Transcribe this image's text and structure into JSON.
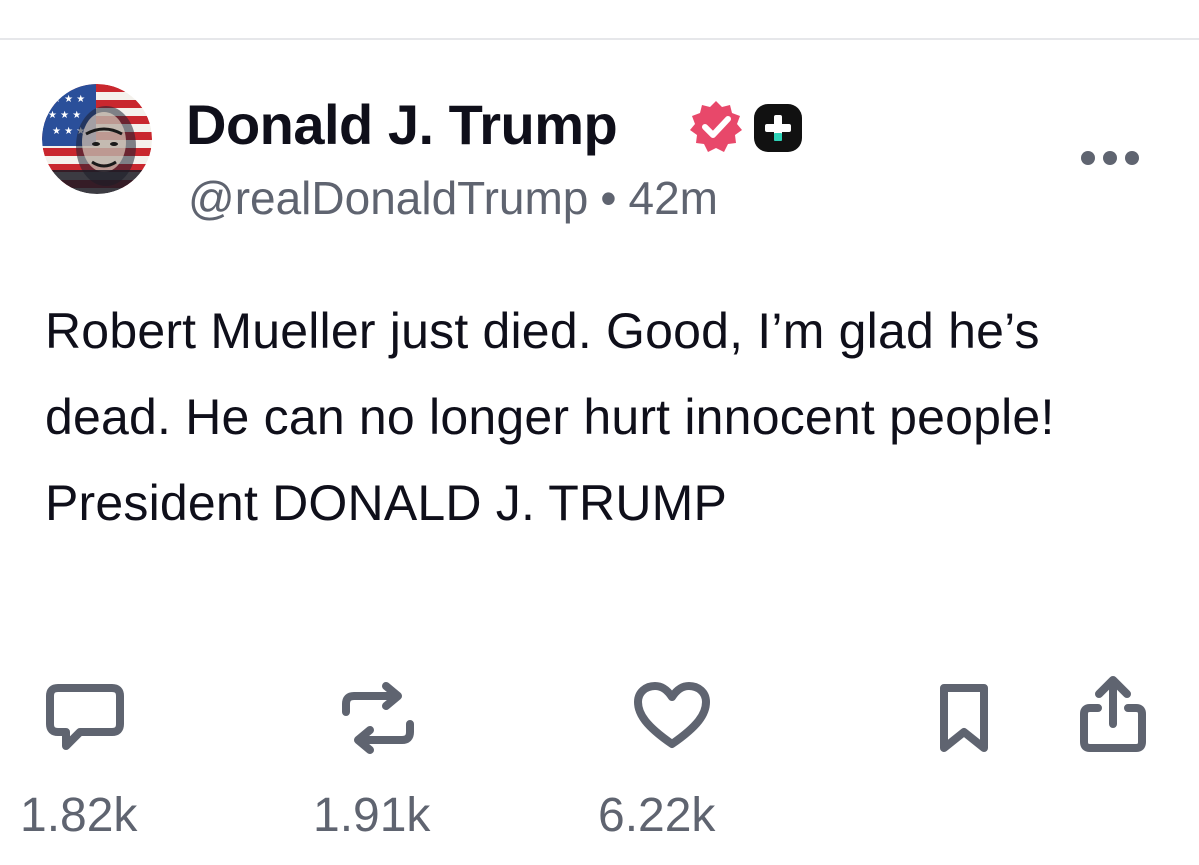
{
  "post": {
    "author": {
      "display_name": "Donald J. Trump",
      "handle": "@realDonaldTrump",
      "separator": "•",
      "timestamp": "42m",
      "avatar_icon": "flag-portrait-avatar",
      "verified_icon": "verified-badge-icon",
      "plus_icon": "plus-badge-icon"
    },
    "text": "Robert Mueller just died. Good, I’m glad he’s dead. He can no longer hurt innocent people! President DONALD J. TRUMP",
    "actions": {
      "reply": {
        "icon": "comment-icon",
        "count": "1.82k"
      },
      "repost": {
        "icon": "repost-icon",
        "count": "1.91k"
      },
      "like": {
        "icon": "heart-icon",
        "count": "6.22k"
      },
      "bookmark": {
        "icon": "bookmark-icon"
      },
      "share": {
        "icon": "share-icon"
      }
    },
    "more_icon": "more-horizontal-icon"
  },
  "colors": {
    "text_primary": "#0f0f1a",
    "text_secondary": "#5f6470",
    "icon_gray": "#5f6470",
    "verified_pink": "#e8486a",
    "plus_badge_bg": "#111111",
    "plus_badge_accent": "#2ed3b7",
    "divider": "#e6e7ea"
  }
}
